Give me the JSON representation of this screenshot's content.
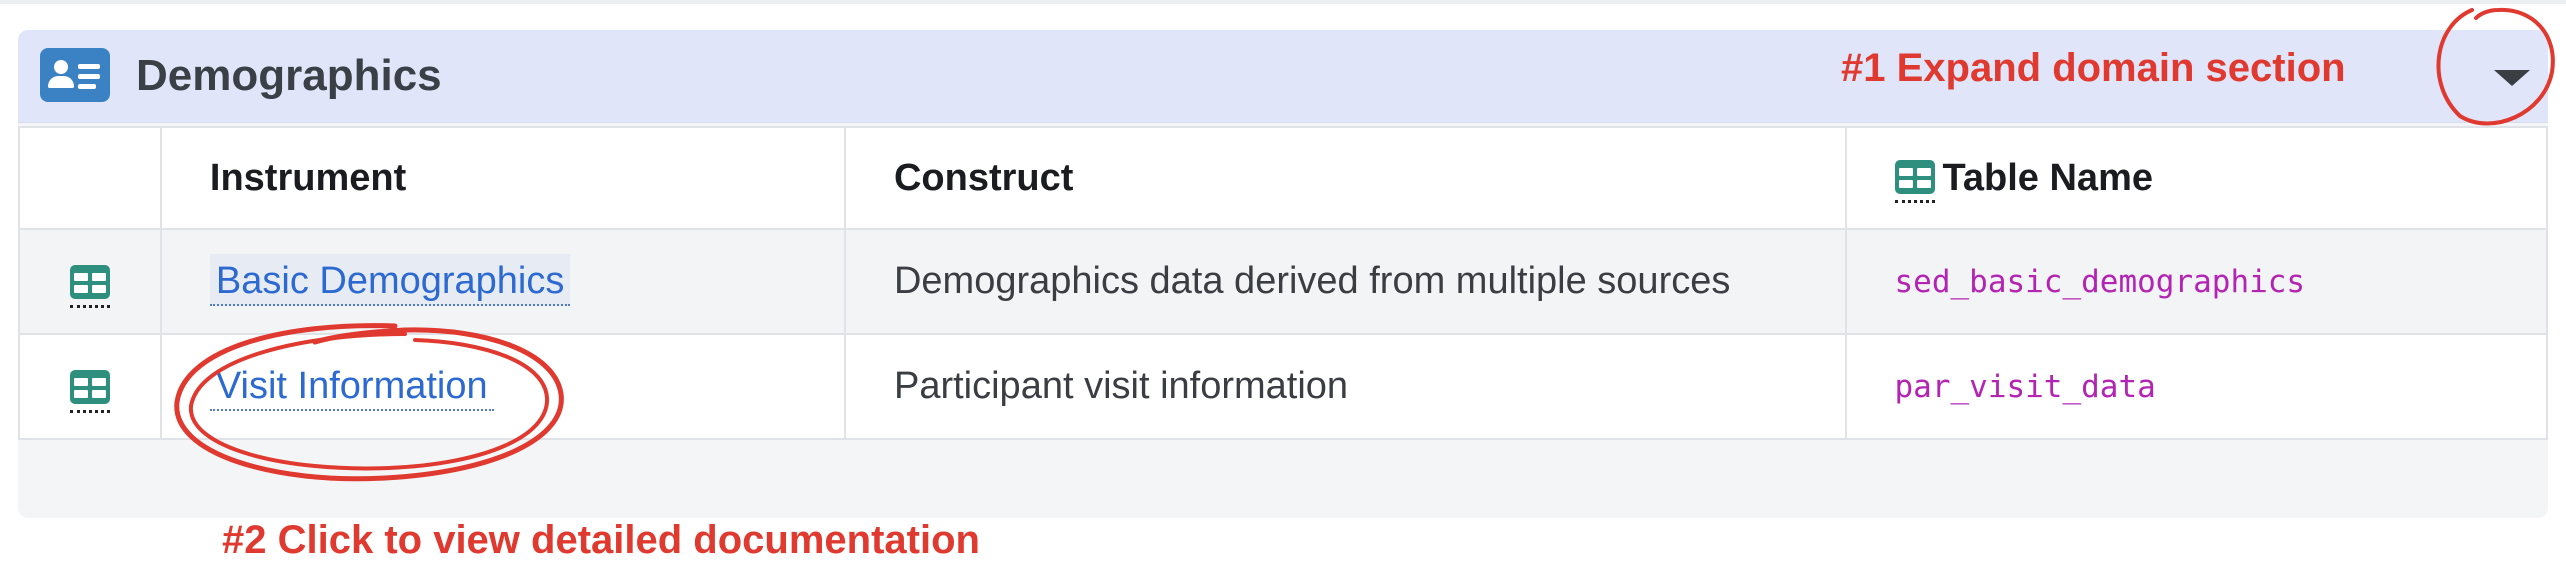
{
  "domain": {
    "title": "Demographics",
    "icon": "id-card-icon",
    "toggle_icon": "caret-down-icon",
    "header_color": "#e0e5fa",
    "icon_color": "#3b82c4"
  },
  "annotations": {
    "step1": "#1 Expand domain section",
    "step2": "#2 Click to view detailed documentation",
    "color": "#e0392f"
  },
  "table": {
    "columns": {
      "instrument": "Instrument",
      "construct": "Construct",
      "table_name": "Table Name"
    },
    "rows": [
      {
        "icon": "table-icon",
        "instrument": "Basic Demographics",
        "construct": "Demographics data derived from multiple sources",
        "table_name": "sed_basic_demographics"
      },
      {
        "icon": "table-icon",
        "instrument": "Visit Information",
        "construct": "Participant visit information",
        "table_name": "par_visit_data"
      }
    ],
    "link_color": "#2c6ad1",
    "table_name_color": "#b424b4",
    "table_icon_color": "#2f8f7f"
  }
}
